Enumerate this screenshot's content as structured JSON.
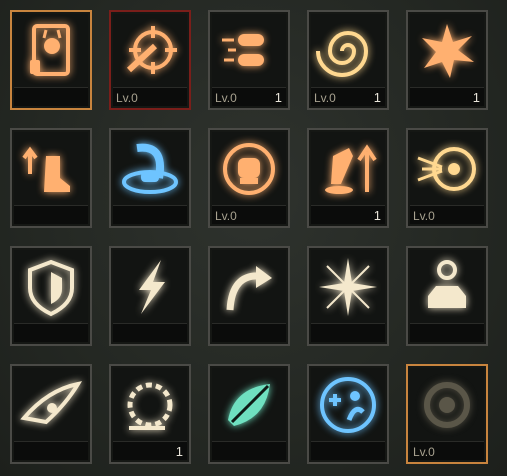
{
  "slots": [
    {
      "icon": "demon-card-icon",
      "level": "",
      "count": "",
      "tint": "orange",
      "selected": "orange"
    },
    {
      "icon": "crosshair-bullet-icon",
      "level": "Lv.0",
      "count": "",
      "tint": "orange",
      "selected": "red"
    },
    {
      "icon": "speeding-bullets-icon",
      "level": "Lv.0",
      "count": "1",
      "tint": "orange",
      "selected": ""
    },
    {
      "icon": "swirl-vortex-icon",
      "level": "Lv.0",
      "count": "1",
      "tint": "gold",
      "selected": ""
    },
    {
      "icon": "explosion-burst-icon",
      "level": "",
      "count": "1",
      "tint": "orange",
      "selected": ""
    },
    {
      "icon": "boot-upgrade-icon",
      "level": "",
      "count": "",
      "tint": "orange",
      "selected": ""
    },
    {
      "icon": "ice-splash-icon",
      "level": "",
      "count": "",
      "tint": "blue",
      "selected": ""
    },
    {
      "icon": "fire-fist-icon",
      "level": "Lv.0",
      "count": "",
      "tint": "orange",
      "selected": ""
    },
    {
      "icon": "flask-upgrade-icon",
      "level": "",
      "count": "1",
      "tint": "orange",
      "selected": ""
    },
    {
      "icon": "target-blast-icon",
      "level": "Lv.0",
      "count": "",
      "tint": "gold",
      "selected": ""
    },
    {
      "icon": "shield-icon",
      "level": "",
      "count": "",
      "tint": "cream",
      "selected": ""
    },
    {
      "icon": "lightning-bolt-icon",
      "level": "",
      "count": "",
      "tint": "cream",
      "selected": ""
    },
    {
      "icon": "curved-arrow-icon",
      "level": "",
      "count": "",
      "tint": "cream",
      "selected": ""
    },
    {
      "icon": "starburst-icon",
      "level": "",
      "count": "",
      "tint": "cream",
      "selected": ""
    },
    {
      "icon": "anvil-gem-icon",
      "level": "",
      "count": "",
      "tint": "cream",
      "selected": ""
    },
    {
      "icon": "eagle-eye-icon",
      "level": "",
      "count": "",
      "tint": "cream",
      "selected": ""
    },
    {
      "icon": "thorn-ring-icon",
      "level": "",
      "count": "1",
      "tint": "cream",
      "selected": ""
    },
    {
      "icon": "poison-leaf-icon",
      "level": "",
      "count": "",
      "tint": "teal",
      "selected": ""
    },
    {
      "icon": "heal-figure-icon",
      "level": "",
      "count": "",
      "tint": "blue",
      "selected": ""
    },
    {
      "icon": "locked-emblem-icon",
      "level": "Lv.0",
      "count": "",
      "tint": "dim",
      "selected": "orange"
    }
  ],
  "tints": {
    "orange": "#ffb070",
    "gold": "#ffd890",
    "cream": "#f4e8cc",
    "blue": "#6ec4ff",
    "teal": "#6fe0c0",
    "dim": "#5a5648"
  }
}
